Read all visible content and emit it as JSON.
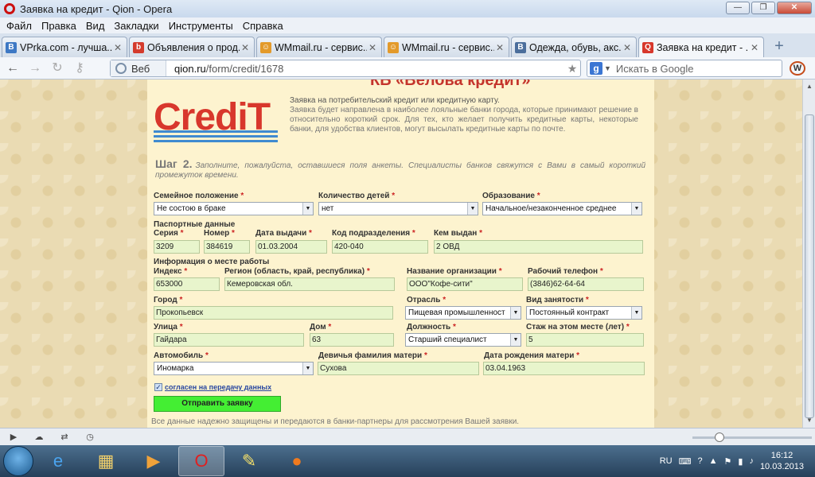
{
  "window": {
    "title": "Заявка на кредит - Qion - Opera"
  },
  "menu": [
    "Файл",
    "Правка",
    "Вид",
    "Закладки",
    "Инструменты",
    "Справка"
  ],
  "tabs": [
    {
      "label": "VPrka.com - лучша...",
      "fav": "B",
      "color": "#3d78c4"
    },
    {
      "label": "Объявления о прод...",
      "fav": "b",
      "color": "#d43b2d"
    },
    {
      "label": "WMmail.ru - сервис...",
      "fav": "☺",
      "color": "#e39a2b"
    },
    {
      "label": "WMmail.ru - сервис...",
      "fav": "☺",
      "color": "#e39a2b"
    },
    {
      "label": "Одежда, обувь, акс...",
      "fav": "B",
      "color": "#4b6e9c"
    },
    {
      "label": "Заявка на кредит - ...",
      "fav": "Q",
      "color": "#d7382c",
      "active": true
    }
  ],
  "address": {
    "web_label": "Веб",
    "host": "qion.ru",
    "path": "/form/credit/1678",
    "search_placeholder": "Искать в Google"
  },
  "page": {
    "top_clip": "КБ «Велова кредит»",
    "logo": "CrediT",
    "intro_first": "Заявка на потребительский кредит или кредитную карту.",
    "intro_rest": "Заявка будет направлена в наиболее лояльные банки города, которые принимают решение в относительно короткий срок. Для тех, кто желает получить кредитные карты, некоторые банки, для удобства клиентов, могут высылать кредитные карты по почте.",
    "step_title": "Шаг 2.",
    "step_text": "Заполните, пожалуйста, оставшиеся поля анкеты. Специалисты банков свяжутся с Вами в самый короткий промежуток времени.",
    "labels": {
      "family": "Семейное положение",
      "children": "Количество детей",
      "education": "Образование",
      "passport": "Паспортные данные",
      "series": "Серия",
      "number": "Номер",
      "issue_date": "Дата выдачи",
      "subdiv_code": "Код подразделения",
      "issued_by": "Кем выдан",
      "work_info": "Информация о месте работы",
      "index": "Индекс",
      "region": "Регион (область, край, республика)",
      "org_name": "Название организации",
      "work_phone": "Рабочий телефон",
      "city": "Город",
      "industry": "Отрасль",
      "employment": "Вид занятости",
      "street": "Улица",
      "house": "Дом",
      "position": "Должность",
      "tenure": "Стаж на этом месте (лет)",
      "car": "Автомобиль",
      "mother_maiden": "Девичья фамилия матери",
      "mother_dob": "Дата рождения матери"
    },
    "values": {
      "family": "Не состою  в браке",
      "children": "нет",
      "education": "Начальное/незаконченное   среднее",
      "series": "3209",
      "number": "384619",
      "issue_date": "01.03.2004",
      "subdiv_code": "420-040",
      "issued_by": "2 ОВД",
      "index": "653000",
      "region": "Кемеровская   обл.",
      "org_name": "ООО\"Кофе-сити\"",
      "work_phone": "(3846)62-64-64",
      "city": "Прокопьевск",
      "industry": "Пищевая  промышленност",
      "employment": "Постоянный  контракт",
      "street": "Гайдара",
      "house": "63",
      "position": "Старший  специалист",
      "tenure": "5",
      "car": "Иномарка",
      "mother_maiden": "Сухова",
      "mother_dob": "03.04.1963"
    },
    "required_mark": "*",
    "agree_label": "согласен на передачу данных",
    "submit_label": "Отправить заявку",
    "footnote": "Все данные надежно защищены и передаются в банки-партнеры для рассмотрения Вашей заявки."
  },
  "tray": {
    "lang": "RU",
    "time": "16:12",
    "date": "10.03.2013"
  }
}
